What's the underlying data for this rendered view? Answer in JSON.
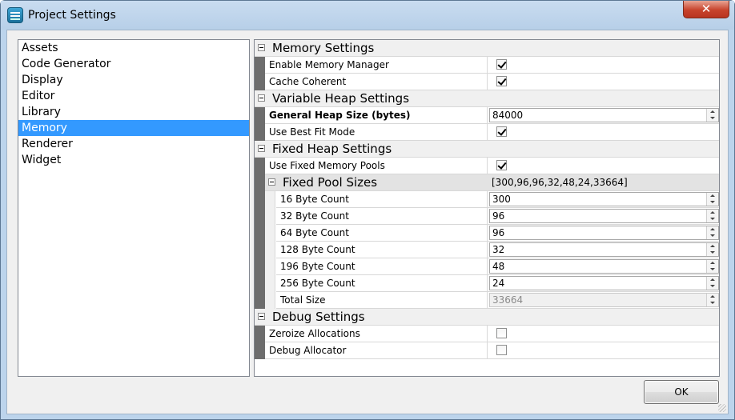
{
  "window": {
    "title": "Project Settings",
    "close_label": "✕"
  },
  "sidebar": {
    "items": [
      {
        "label": "Assets",
        "selected": false
      },
      {
        "label": "Code Generator",
        "selected": false
      },
      {
        "label": "Display",
        "selected": false
      },
      {
        "label": "Editor",
        "selected": false
      },
      {
        "label": "Library",
        "selected": false
      },
      {
        "label": "Memory",
        "selected": true
      },
      {
        "label": "Renderer",
        "selected": false
      },
      {
        "label": "Widget",
        "selected": false
      }
    ]
  },
  "grid": {
    "memory_settings": {
      "label": "Memory Settings",
      "enable_memory_manager": {
        "label": "Enable Memory Manager",
        "checked": true
      },
      "cache_coherent": {
        "label": "Cache Coherent",
        "checked": true
      }
    },
    "variable_heap": {
      "label": "Variable Heap Settings",
      "general_heap_size": {
        "label": "General Heap Size (bytes)",
        "value": "84000"
      },
      "use_best_fit": {
        "label": "Use Best Fit Mode",
        "checked": true
      }
    },
    "fixed_heap": {
      "label": "Fixed Heap Settings",
      "use_fixed_pools": {
        "label": "Use Fixed Memory Pools",
        "checked": true
      },
      "pool_sizes": {
        "label": "Fixed Pool Sizes",
        "summary": "[300,96,96,32,48,24,33664]",
        "rows": [
          {
            "label": "16 Byte Count",
            "value": "300"
          },
          {
            "label": "32 Byte Count",
            "value": "96"
          },
          {
            "label": "64 Byte Count",
            "value": "96"
          },
          {
            "label": "128 Byte Count",
            "value": "32"
          },
          {
            "label": "196 Byte Count",
            "value": "48"
          },
          {
            "label": "256 Byte Count",
            "value": "24"
          }
        ],
        "total": {
          "label": "Total Size",
          "value": "33664"
        }
      }
    },
    "debug": {
      "label": "Debug Settings",
      "zeroize": {
        "label": "Zeroize Allocations",
        "checked": false
      },
      "debug_allocator": {
        "label": "Debug Allocator",
        "checked": false
      }
    }
  },
  "footer": {
    "ok_label": "OK"
  },
  "icons": {
    "app": "app-logo-icon",
    "close": "close-icon",
    "collapse": "collapse-icon",
    "spin": "spin-arrows-icon",
    "check": "checkmark-icon"
  }
}
